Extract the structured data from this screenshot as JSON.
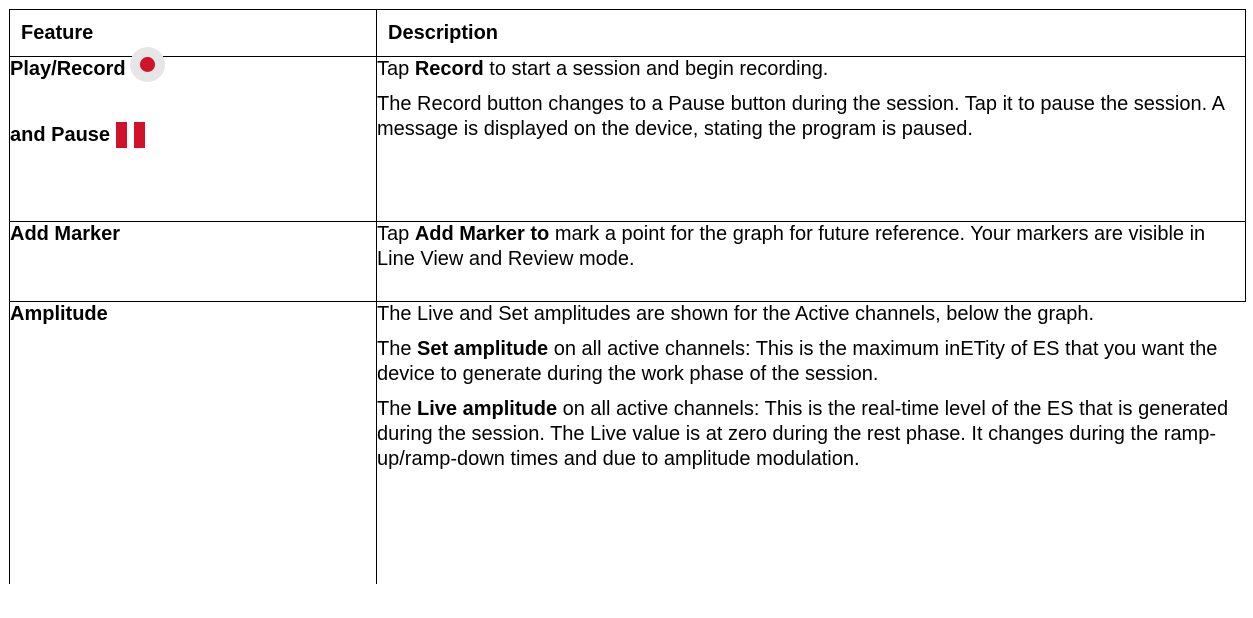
{
  "table": {
    "header": {
      "feature": "Feature",
      "description": "Description"
    },
    "rows": [
      {
        "feature_line1": "Play/Record",
        "feature_icon1": "record-icon",
        "feature_line2": "and Pause",
        "feature_icon2": "pause-icon",
        "paragraphs": [
          {
            "pre": "Tap ",
            "bold": "Record",
            "post": " to start a session and begin recording."
          },
          {
            "pre": "The Record button changes to a Pause button during the session. Tap it to pause the session. A message is displayed on the device, stating the program is paused.",
            "bold": "",
            "post": ""
          }
        ]
      },
      {
        "feature": "Add Marker",
        "paragraphs": [
          {
            "pre": "Tap ",
            "bold": "Add Marker to",
            "post": " mark a point for the graph for future reference. Your markers are visible in Line View and Review mode."
          }
        ]
      },
      {
        "feature": "Amplitude",
        "paragraphs": [
          {
            "pre": "The Live and Set amplitudes are shown for the Active channels, below the graph.",
            "bold": "",
            "post": ""
          },
          {
            "pre": "The ",
            "bold": "Set amplitude",
            "post": " on all active channels: This is the maximum inETity of ES that you want the device to generate during the work phase of the session."
          },
          {
            "pre": "The ",
            "bold": "Live amplitude",
            "post": " on all active channels: This is the real-time level of the ES that is generated during the session. The Live value is at zero during the rest phase. It changes during the ramp-up/ramp-down times and due to amplitude modulation."
          }
        ]
      }
    ]
  },
  "colors": {
    "icon_red": "#d2112a",
    "icon_circle_bg": "#e6e6e6"
  }
}
